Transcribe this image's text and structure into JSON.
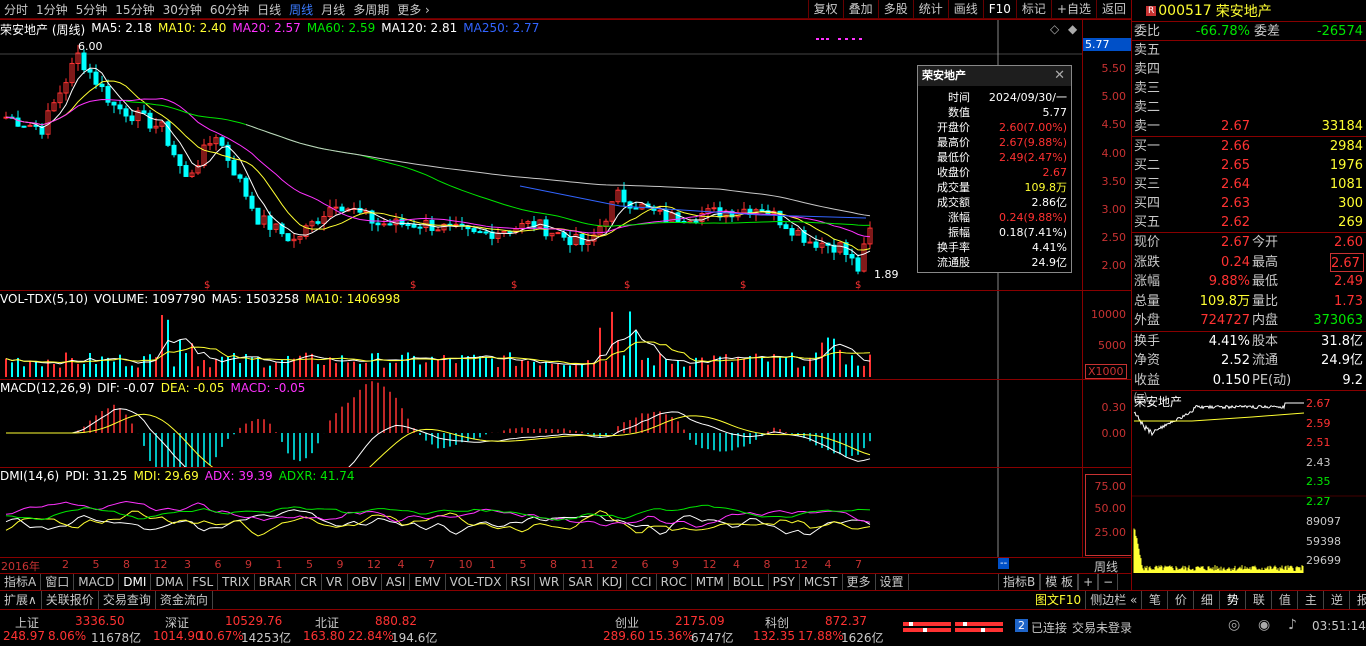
{
  "periods": [
    "分时",
    "1分钟",
    "5分钟",
    "15分钟",
    "30分钟",
    "60分钟",
    "日线",
    "周线",
    "月线",
    "多周期",
    "更多 ›"
  ],
  "active_period": "周线",
  "tools": [
    "复权",
    "叠加",
    "多股",
    "统计",
    "画线",
    "F10",
    "标记",
    "+自选",
    "返回"
  ],
  "stock": {
    "code": "000517",
    "name": "荣安地产",
    "badge": "R"
  },
  "main_info": {
    "title": "荣安地产 (周线)",
    "ma5": "MA5: 2.18",
    "ma10": "MA10: 2.40",
    "ma20": "MA20: 2.57",
    "ma60": "MA60: 2.59",
    "ma120": "MA120: 2.81",
    "ma250": "MA250: 2.77"
  },
  "price_ticks": [
    "5.50",
    "5.00",
    "4.50",
    "4.00",
    "3.50",
    "3.00",
    "2.50",
    "2.00"
  ],
  "cursor_price": "5.77",
  "high_mark": "6.00",
  "low_mark": "1.89",
  "popup": {
    "title": "荣安地产",
    "rows": [
      {
        "k": "时间",
        "v": "2024/09/30/一",
        "c": "wht"
      },
      {
        "k": "数值",
        "v": "5.77",
        "c": "wht"
      },
      {
        "k": "开盘价",
        "v": "2.60(7.00%)",
        "c": "red"
      },
      {
        "k": "最高价",
        "v": "2.67(9.88%)",
        "c": "red"
      },
      {
        "k": "最低价",
        "v": "2.49(2.47%)",
        "c": "red"
      },
      {
        "k": "收盘价",
        "v": "2.67",
        "c": "red"
      },
      {
        "k": "成交量",
        "v": "109.8万",
        "c": "yel"
      },
      {
        "k": "成交额",
        "v": "2.86亿",
        "c": "wht"
      },
      {
        "k": "涨幅",
        "v": "0.24(9.88%)",
        "c": "red"
      },
      {
        "k": "振幅",
        "v": "0.18(7.41%)",
        "c": "wht"
      },
      {
        "k": "换手率",
        "v": "4.41%",
        "c": "wht"
      },
      {
        "k": "流通股",
        "v": "24.9亿",
        "c": "wht"
      }
    ]
  },
  "vol_info": {
    "title": "VOL-TDX(5,10)",
    "volume": "VOLUME: 1097790",
    "ma5": "MA5: 1503258",
    "ma10": "MA10: 1406998"
  },
  "vol_ticks": [
    "10000",
    "5000"
  ],
  "vol_unit": "X1000",
  "macd_info": {
    "title": "MACD(12,26,9)",
    "dif": "DIF: -0.07",
    "dea": "DEA: -0.05",
    "macd": "MACD: -0.05"
  },
  "macd_ticks": [
    "0.30",
    "0.00"
  ],
  "dmi_info": {
    "title": "DMI(14,6)",
    "pdi": "PDI: 31.25",
    "mdi": "MDI: 29.69",
    "adx": "ADX: 39.39",
    "adxr": "ADXR: 41.74"
  },
  "dmi_ticks": [
    "75.00",
    "50.00",
    "25.00"
  ],
  "xaxis": {
    "start": "2016年",
    "months": [
      "2",
      "5",
      "8",
      "12",
      "3",
      "6",
      "9",
      "1",
      "5",
      "9",
      "12",
      "4",
      "7",
      "10",
      "1",
      "5",
      "8",
      "11",
      "2",
      "6",
      "9",
      "12",
      "4",
      "8",
      "12",
      "4",
      "7"
    ]
  },
  "period_label": "周线",
  "indicator_tabs": [
    "指标A",
    "窗口",
    "MACD",
    "DMI",
    "DMA",
    "FSL",
    "TRIX",
    "BRAR",
    "CR",
    "VR",
    "OBV",
    "ASI",
    "EMV",
    "VOL-TDX",
    "RSI",
    "WR",
    "SAR",
    "KDJ",
    "CCI",
    "ROC",
    "MTM",
    "BOLL",
    "PSY",
    "MCST",
    "更多",
    "设置"
  ],
  "active_indicator": "DMI",
  "index_tabs": [
    "指标B",
    "模 板",
    "+",
    "−"
  ],
  "quote": {
    "weibi_label": "委比",
    "weibi": "-66.78%",
    "weicha_label": "委差",
    "weicha": "-26574",
    "asks": [
      {
        "l": "卖五",
        "p": "",
        "v": ""
      },
      {
        "l": "卖四",
        "p": "",
        "v": ""
      },
      {
        "l": "卖三",
        "p": "",
        "v": ""
      },
      {
        "l": "卖二",
        "p": "",
        "v": ""
      },
      {
        "l": "卖一",
        "p": "2.67",
        "v": "33184"
      }
    ],
    "bids": [
      {
        "l": "买一",
        "p": "2.66",
        "v": "2984"
      },
      {
        "l": "买二",
        "p": "2.65",
        "v": "1976"
      },
      {
        "l": "买三",
        "p": "2.64",
        "v": "1081"
      },
      {
        "l": "买四",
        "p": "2.63",
        "v": "300"
      },
      {
        "l": "买五",
        "p": "2.62",
        "v": "269"
      }
    ],
    "stats": [
      {
        "a": "现价",
        "b": "2.67",
        "bc": "red",
        "c": "今开",
        "d": "2.60",
        "dc": "red"
      },
      {
        "a": "涨跌",
        "b": "0.24",
        "bc": "red",
        "c": "最高",
        "d": "2.67",
        "dc": "red"
      },
      {
        "a": "涨幅",
        "b": "9.88%",
        "bc": "red",
        "c": "最低",
        "d": "2.49",
        "dc": "red"
      },
      {
        "a": "总量",
        "b": "109.8万",
        "bc": "yel",
        "c": "量比",
        "d": "1.73",
        "dc": "red"
      },
      {
        "a": "外盘",
        "b": "724727",
        "bc": "red",
        "c": "内盘",
        "d": "373063",
        "dc": "grn"
      }
    ],
    "stats2": [
      {
        "a": "换手",
        "b": "4.41%",
        "bc": "wht",
        "c": "股本",
        "d": "31.8亿",
        "dc": "wht"
      },
      {
        "a": "净资",
        "b": "2.52",
        "bc": "wht",
        "c": "流通",
        "d": "24.9亿",
        "dc": "wht"
      },
      {
        "a": "收益㈢",
        "b": "0.150",
        "bc": "wht",
        "c": "PE(动)",
        "d": "9.2",
        "dc": "wht"
      }
    ]
  },
  "mini_chart": {
    "title": "荣安地产",
    "price_ticks": [
      "2.67",
      "2.59",
      "2.51",
      "2.43",
      "2.35",
      "2.27"
    ],
    "vol_ticks": [
      "89097",
      "59398",
      "29699"
    ]
  },
  "right_tabs": [
    "图文F10",
    "侧边栏 «",
    "笔",
    "价",
    "细",
    "势",
    "联",
    "值",
    "主",
    "逆",
    "报"
  ],
  "bottom_tabs": [
    "扩展∧",
    "关联报价",
    "交易查询",
    "资金流向"
  ],
  "indices": [
    {
      "name": "上证",
      "value": "3336.50",
      "chg": "248.97",
      "pct": "8.06%",
      "amt": "11678亿"
    },
    {
      "name": "深证",
      "value": "10529.76",
      "chg": "1014.90",
      "pct": "10.67%",
      "amt": "14253亿"
    },
    {
      "name": "北证",
      "value": "880.82",
      "chg": "163.80",
      "pct": "22.84%",
      "amt": "194.6亿"
    },
    {
      "name": "创业",
      "value": "2175.09",
      "chg": "289.60",
      "pct": "15.36%",
      "amt": "6747亿"
    },
    {
      "name": "科创",
      "value": "872.37",
      "chg": "132.35",
      "pct": "17.88%",
      "amt": "1626亿"
    }
  ],
  "connection": {
    "count": "2",
    "status": "已连接",
    "trade": "交易未登录",
    "time": "03:51:14"
  },
  "colors": {
    "up": "#ff3232",
    "down": "#00ffff",
    "ma5": "#ffffff",
    "ma10": "#ffff32",
    "ma20": "#ff32ff",
    "ma60": "#00e600",
    "ma120": "#c8c8c8",
    "ma250": "#3264ff"
  }
}
